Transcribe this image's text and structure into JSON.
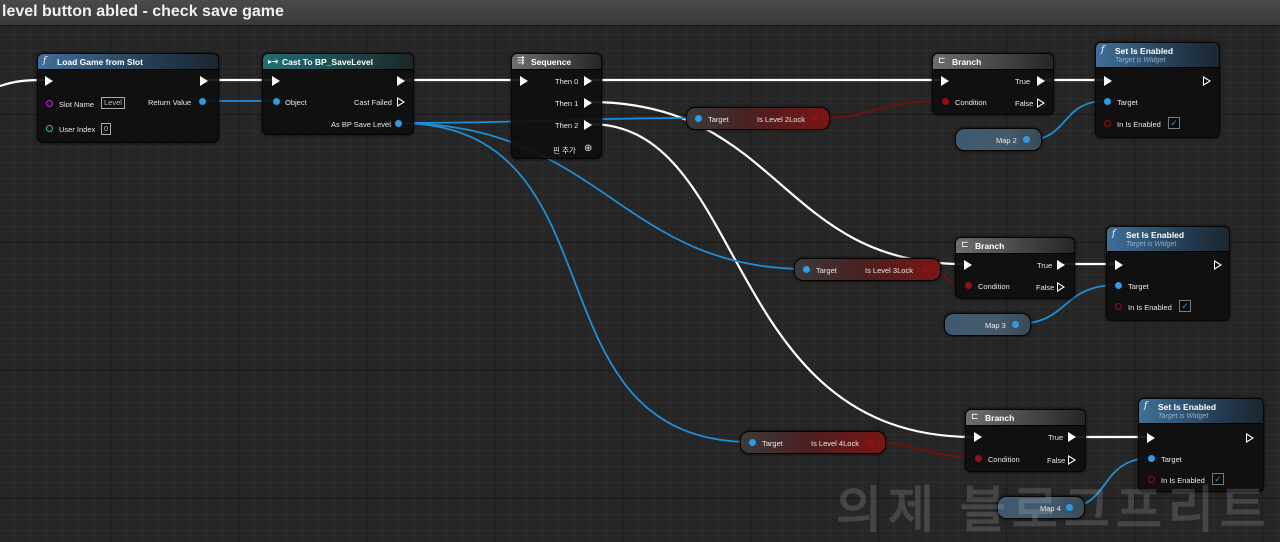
{
  "window": {
    "title": "level button abled - check save game"
  },
  "nodes": {
    "load_game": {
      "title": "Load Game from Slot",
      "slot_name_label": "Slot Name",
      "slot_name_value": "Level",
      "user_index_label": "User Index",
      "user_index_value": "0",
      "return_value_label": "Return Value"
    },
    "cast": {
      "title": "Cast To BP_SaveLevel",
      "object_label": "Object",
      "cast_failed_label": "Cast Failed",
      "as_label": "As BP Save Level"
    },
    "sequence": {
      "title": "Sequence",
      "then0": "Then 0",
      "then1": "Then 1",
      "then2": "Then 2",
      "add_pin": "핀 추가"
    },
    "branch1": {
      "title": "Branch",
      "condition": "Condition",
      "true_label": "True",
      "false_label": "False"
    },
    "branch2": {
      "title": "Branch",
      "condition": "Condition",
      "true_label": "True",
      "false_label": "False"
    },
    "branch3": {
      "title": "Branch",
      "condition": "Condition",
      "true_label": "True",
      "false_label": "False"
    },
    "set1": {
      "title": "Set Is Enabled",
      "subtitle": "Target is Widget",
      "target_label": "Target",
      "enabled_label": "In Is Enabled"
    },
    "set2": {
      "title": "Set Is Enabled",
      "subtitle": "Target is Widget",
      "target_label": "Target",
      "enabled_label": "In Is Enabled"
    },
    "set3": {
      "title": "Set Is Enabled",
      "subtitle": "Target is Widget",
      "target_label": "Target",
      "enabled_label": "In Is Enabled"
    },
    "get_lock2": {
      "target_label": "Target",
      "value_label": "Is Level 2Lock"
    },
    "get_lock3": {
      "target_label": "Target",
      "value_label": "Is Level 3Lock"
    },
    "get_lock4": {
      "target_label": "Target",
      "value_label": "Is Level 4Lock"
    },
    "map2": {
      "label": "Map 2"
    },
    "map3": {
      "label": "Map 3"
    },
    "map4": {
      "label": "Map 4"
    }
  },
  "watermark": "의제 블로그프리트",
  "colors": {
    "exec_wire": "#ffffff",
    "object_wire": "#1f8ed6",
    "bool_wire": "#7a0e0e",
    "function_header": "#3f6f98",
    "cast_header": "#1f6e73"
  }
}
